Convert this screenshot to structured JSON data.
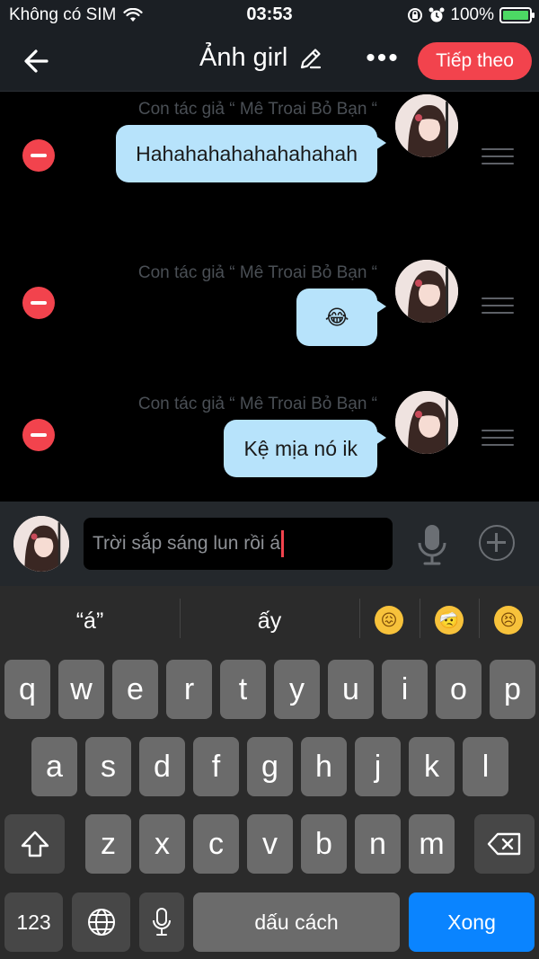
{
  "status_bar": {
    "carrier": "Không có SIM",
    "time": "03:53",
    "battery": "100%",
    "battery_level": 1.0
  },
  "nav": {
    "title": "Ảnh girl",
    "next_label": "Tiếp theo"
  },
  "messages": [
    {
      "sender": "Con tác giả “ Mê Troai Bỏ Bạn “",
      "text": "Hahahahahahahahahah"
    },
    {
      "sender": "Con tác giả “ Mê Troai Bỏ Bạn “",
      "text": "😂"
    },
    {
      "sender": "Con tác giả “ Mê Troai Bỏ Bạn “",
      "text": "Kệ mịa nó ik"
    }
  ],
  "composer": {
    "input_value": "Trời sắp sáng lun rồi á"
  },
  "keyboard": {
    "suggestions": [
      "“á”",
      "ấy"
    ],
    "emoji_suggestions": [
      "😖",
      "🤕",
      "😣"
    ],
    "row1": [
      "q",
      "w",
      "e",
      "r",
      "t",
      "y",
      "u",
      "i",
      "o",
      "p"
    ],
    "row2": [
      "a",
      "s",
      "d",
      "f",
      "g",
      "h",
      "j",
      "k",
      "l"
    ],
    "row3": [
      "z",
      "x",
      "c",
      "v",
      "b",
      "n",
      "m"
    ],
    "numbers_label": "123",
    "space_label": "dấu cách",
    "done_label": "Xong"
  },
  "colors": {
    "accent": "#f2434d",
    "bubble": "#b7e3fb",
    "done_key": "#0a84ff"
  }
}
